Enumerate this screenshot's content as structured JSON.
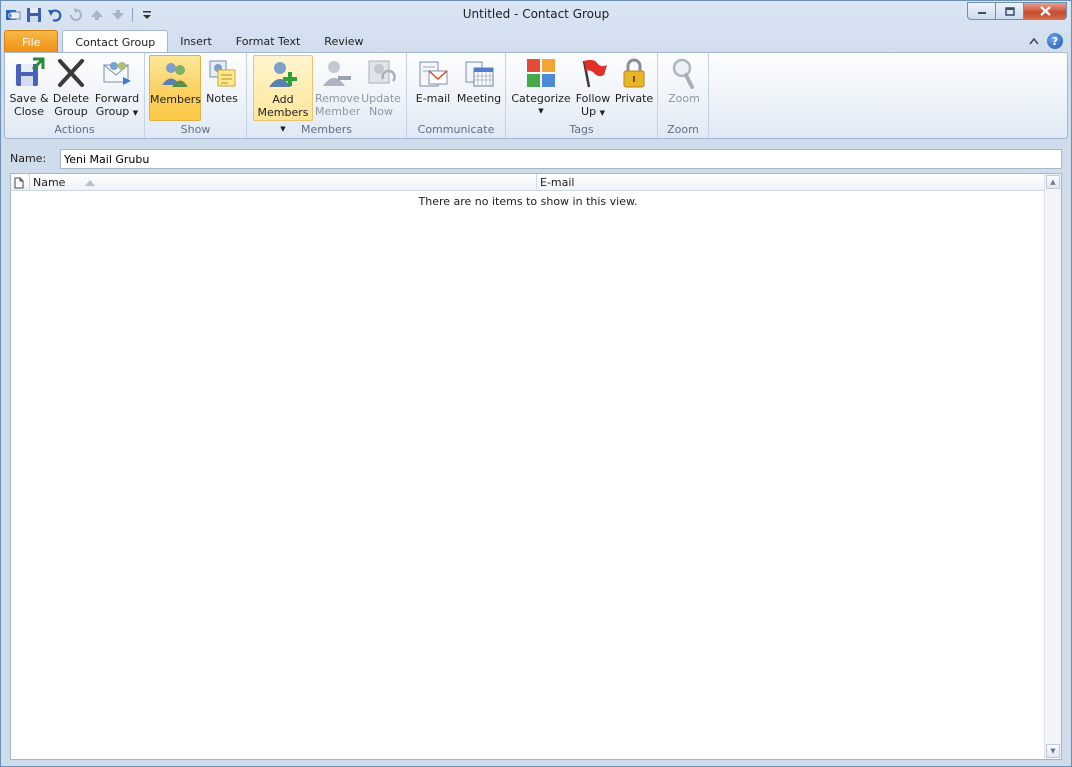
{
  "window": {
    "title": "Untitled  -  Contact Group"
  },
  "qat": {
    "icons": [
      "outlook-icon",
      "save-icon",
      "undo-icon",
      "redo-icon",
      "up-icon",
      "down-icon",
      "customize-icon"
    ]
  },
  "tabs": [
    {
      "label": "File",
      "state": "file"
    },
    {
      "label": "Contact Group",
      "state": "active"
    },
    {
      "label": "Insert",
      "state": "normal"
    },
    {
      "label": "Format Text",
      "state": "normal"
    },
    {
      "label": "Review",
      "state": "normal"
    }
  ],
  "ribbon": {
    "actions": {
      "label": "Actions",
      "save_close": [
        "Save &",
        "Close"
      ],
      "delete_group": [
        "Delete",
        "Group"
      ],
      "forward_group": [
        "Forward",
        "Group"
      ]
    },
    "show": {
      "label": "Show",
      "members": "Members",
      "notes": "Notes"
    },
    "members": {
      "label": "Members",
      "add_members": [
        "Add",
        "Members"
      ],
      "remove_member": [
        "Remove",
        "Member"
      ],
      "update_now": [
        "Update",
        "Now"
      ]
    },
    "communicate": {
      "label": "Communicate",
      "email": "E-mail",
      "meeting": "Meeting"
    },
    "tags": {
      "label": "Tags",
      "categorize": "Categorize",
      "follow_up": [
        "Follow",
        "Up"
      ],
      "private": "Private"
    },
    "zoom": {
      "label": "Zoom",
      "zoom": "Zoom"
    }
  },
  "name_field": {
    "label": "Name:",
    "value": "Yeni Mail Grubu"
  },
  "member_list": {
    "columns": [
      "Name",
      "E-mail"
    ],
    "empty_message": "There are no items to show in this view."
  },
  "colors": {
    "file_tab": "#f08f12",
    "pressed": "#fbd366",
    "accent": "#1a57b0"
  }
}
